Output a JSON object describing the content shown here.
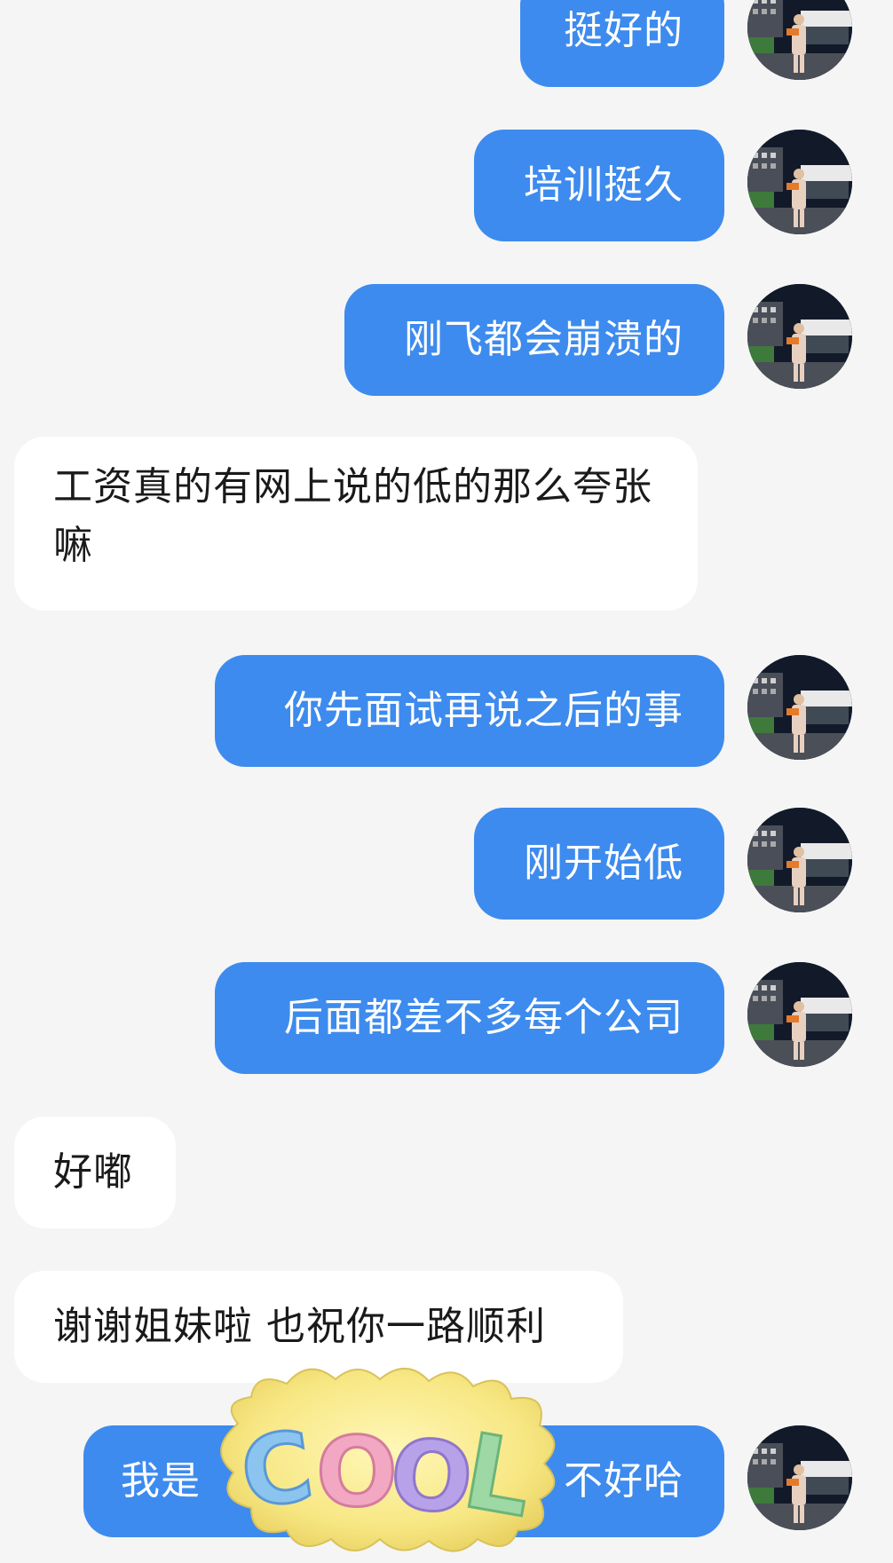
{
  "messages": [
    {
      "side": "out",
      "text": "挺好的"
    },
    {
      "side": "out",
      "text": "培训挺久"
    },
    {
      "side": "out",
      "text": "刚飞都会崩溃的"
    },
    {
      "side": "in",
      "text": "工资真的有网上说的低的那么夸张嘛"
    },
    {
      "side": "out",
      "text": "你先面试再说之后的事"
    },
    {
      "side": "out",
      "text": "刚开始低"
    },
    {
      "side": "out",
      "text": "后面都差不多每个公司"
    },
    {
      "side": "in",
      "text": "好嘟"
    },
    {
      "side": "in",
      "text": "谢谢姐妹啦 也祝你一路顺利"
    },
    {
      "side": "out",
      "text": "我是",
      "text_tail": "不好哈"
    }
  ],
  "sticker": {
    "text": "COOL"
  },
  "avatar": {
    "icon": "user-photo-night-street"
  }
}
